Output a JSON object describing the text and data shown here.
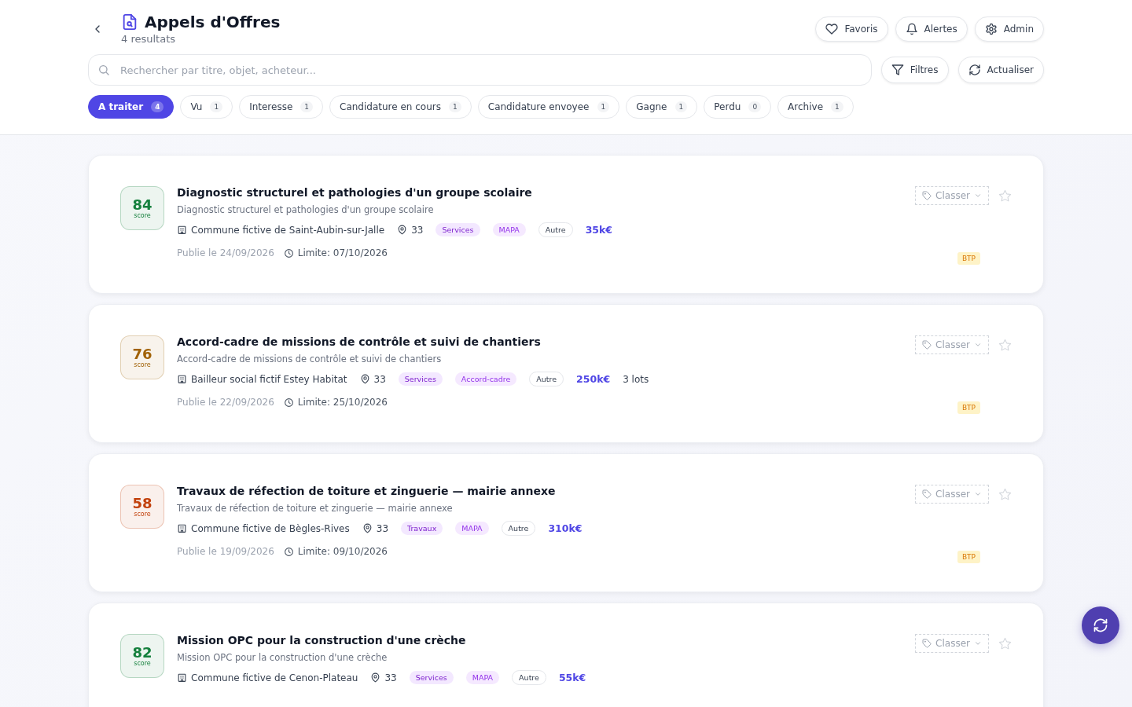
{
  "header": {
    "title": "Appels d'Offres",
    "subtitle": "4 resultats",
    "actions": [
      "Favoris",
      "Alertes",
      "Admin"
    ]
  },
  "search": {
    "placeholder": "Rechercher par titre, objet, acheteur..."
  },
  "toolbar": [
    "Filtres",
    "Actualiser"
  ],
  "tabs": [
    {
      "label": "A traiter",
      "count": "4",
      "selected": true
    },
    {
      "label": "Vu",
      "count": "1",
      "selected": false
    },
    {
      "label": "Interesse",
      "count": "1",
      "selected": false
    },
    {
      "label": "Candidature en cours",
      "count": "1",
      "selected": false
    },
    {
      "label": "Candidature envoyee",
      "count": "1",
      "selected": false
    },
    {
      "label": "Gagne",
      "count": "1",
      "selected": false
    },
    {
      "label": "Perdu",
      "count": "0",
      "selected": false
    },
    {
      "label": "Archive",
      "count": "1",
      "selected": false
    }
  ],
  "results": [
    {
      "score": "84",
      "score_label": "score",
      "color": "#15803d",
      "title": "Diagnostic structurel et pathologies d'un groupe scolaire",
      "description": "Diagnostic structurel et pathologies d'un groupe scolaire",
      "buyer": "Commune fictive de Saint-Aubin-sur-Jalle",
      "department": "33",
      "tags": [
        {
          "label": "Services",
          "kind": "category"
        },
        {
          "label": "MAPA",
          "kind": "procedure"
        },
        {
          "label": "Autre",
          "kind": "other"
        }
      ],
      "amount": "35k€",
      "published": "Publie le 24/09/2026",
      "deadline": "Limite: 07/10/2026",
      "classify": "Classer",
      "favorite": false,
      "sector": "BTP"
    },
    {
      "score": "76",
      "score_label": "score",
      "color": "#a16207",
      "title": "Accord-cadre de missions de contrôle et suivi de chantiers",
      "description": "Accord-cadre de missions de contrôle et suivi de chantiers",
      "buyer": "Bailleur social fictif Estey Habitat",
      "department": "33",
      "tags": [
        {
          "label": "Services",
          "kind": "category"
        },
        {
          "label": "Accord-cadre",
          "kind": "procedure"
        },
        {
          "label": "Autre",
          "kind": "other"
        }
      ],
      "amount": "250k€",
      "lots": "3 lots",
      "published": "Publie le 22/09/2026",
      "deadline": "Limite: 25/10/2026",
      "classify": "Classer",
      "favorite": false,
      "sector": "BTP"
    },
    {
      "score": "58",
      "score_label": "score",
      "color": "#c2410c",
      "title": "Travaux de réfection de toiture et zinguerie — mairie annexe",
      "description": "Travaux de réfection de toiture et zinguerie — mairie annexe",
      "buyer": "Commune fictive de Bègles-Rives",
      "department": "33",
      "tags": [
        {
          "label": "Travaux",
          "kind": "category"
        },
        {
          "label": "MAPA",
          "kind": "procedure"
        },
        {
          "label": "Autre",
          "kind": "other"
        }
      ],
      "amount": "310k€",
      "published": "Publie le 19/09/2026",
      "deadline": "Limite: 09/10/2026",
      "classify": "Classer",
      "favorite": false,
      "sector": "BTP"
    },
    {
      "score": "82",
      "score_label": "score",
      "color": "#15803d",
      "title": "Mission OPC pour la construction d'une crèche",
      "description": "Mission OPC pour la construction d'une crèche",
      "buyer": "Commune fictive de Cenon-Plateau",
      "department": "33",
      "tags": [
        {
          "label": "Services",
          "kind": "category"
        },
        {
          "label": "MAPA",
          "kind": "procedure"
        },
        {
          "label": "Autre",
          "kind": "other"
        }
      ],
      "amount": "55k€",
      "classify": "Classer",
      "favorite": false
    }
  ]
}
